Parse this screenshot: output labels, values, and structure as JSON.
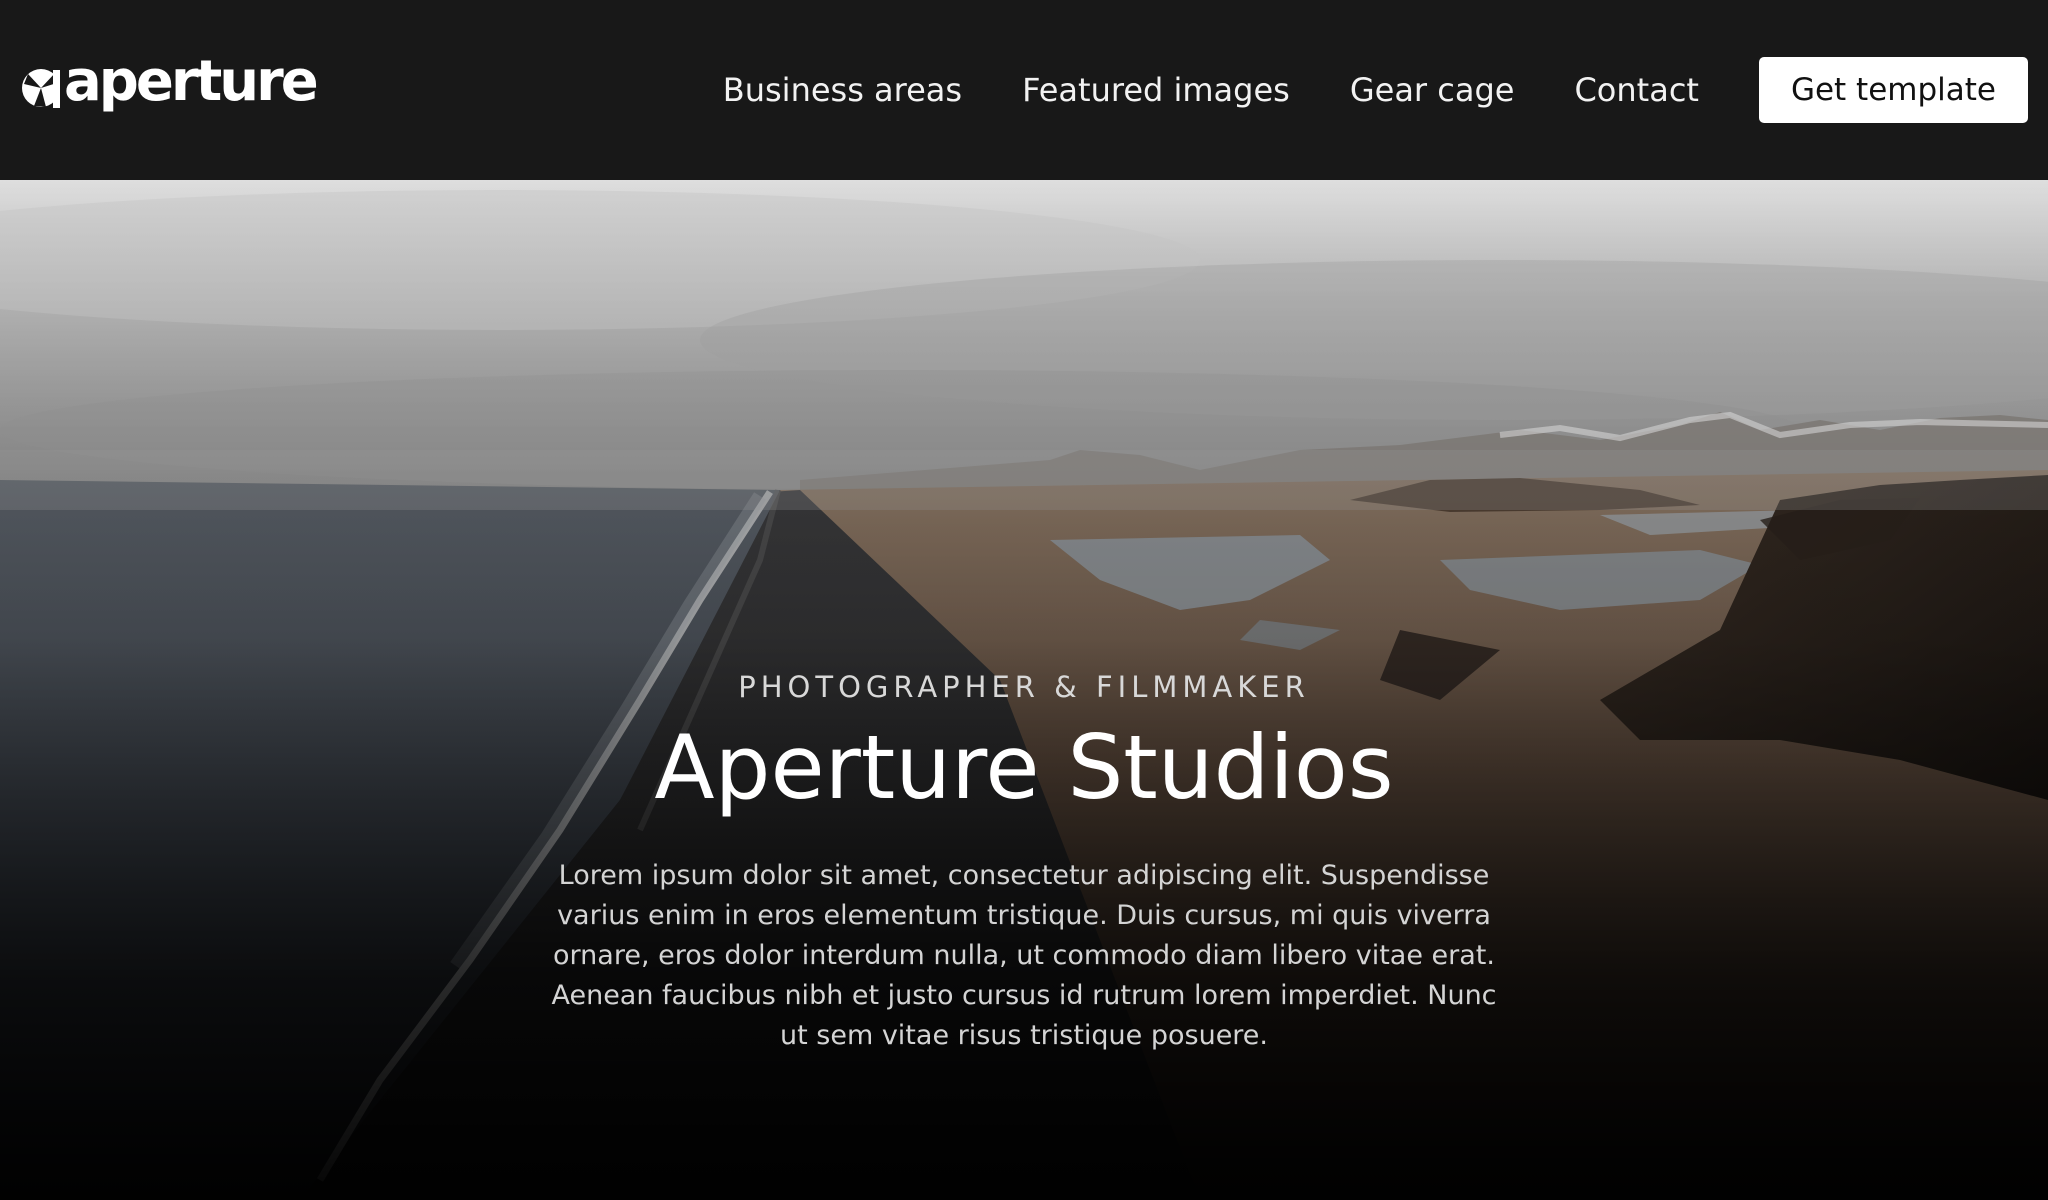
{
  "header": {
    "logo_text": "aperture",
    "nav": [
      {
        "label": "Business areas"
      },
      {
        "label": "Featured images"
      },
      {
        "label": "Gear cage"
      },
      {
        "label": "Contact"
      }
    ],
    "cta_label": "Get template"
  },
  "hero": {
    "eyebrow": "PHOTOGRAPHER & FILMMAKER",
    "title": "Aperture Studios",
    "body": "Lorem ipsum dolor sit amet, consectetur adipiscing elit. Suspendisse varius enim in eros elementum tristique. Duis cursus, mi quis viverra ornare, eros dolor interdum nulla, ut commodo diam libero vitae erat. Aenean faucibus nibh et justo cursus id rutrum lorem imperdiet. Nunc ut sem vitae risus tristique posuere.",
    "background_image": "aerial-coastline-photo"
  },
  "colors": {
    "header_bg": "#181818",
    "cta_bg": "#ffffff",
    "cta_text": "#111111",
    "page_bg": "#0a0a0a"
  }
}
